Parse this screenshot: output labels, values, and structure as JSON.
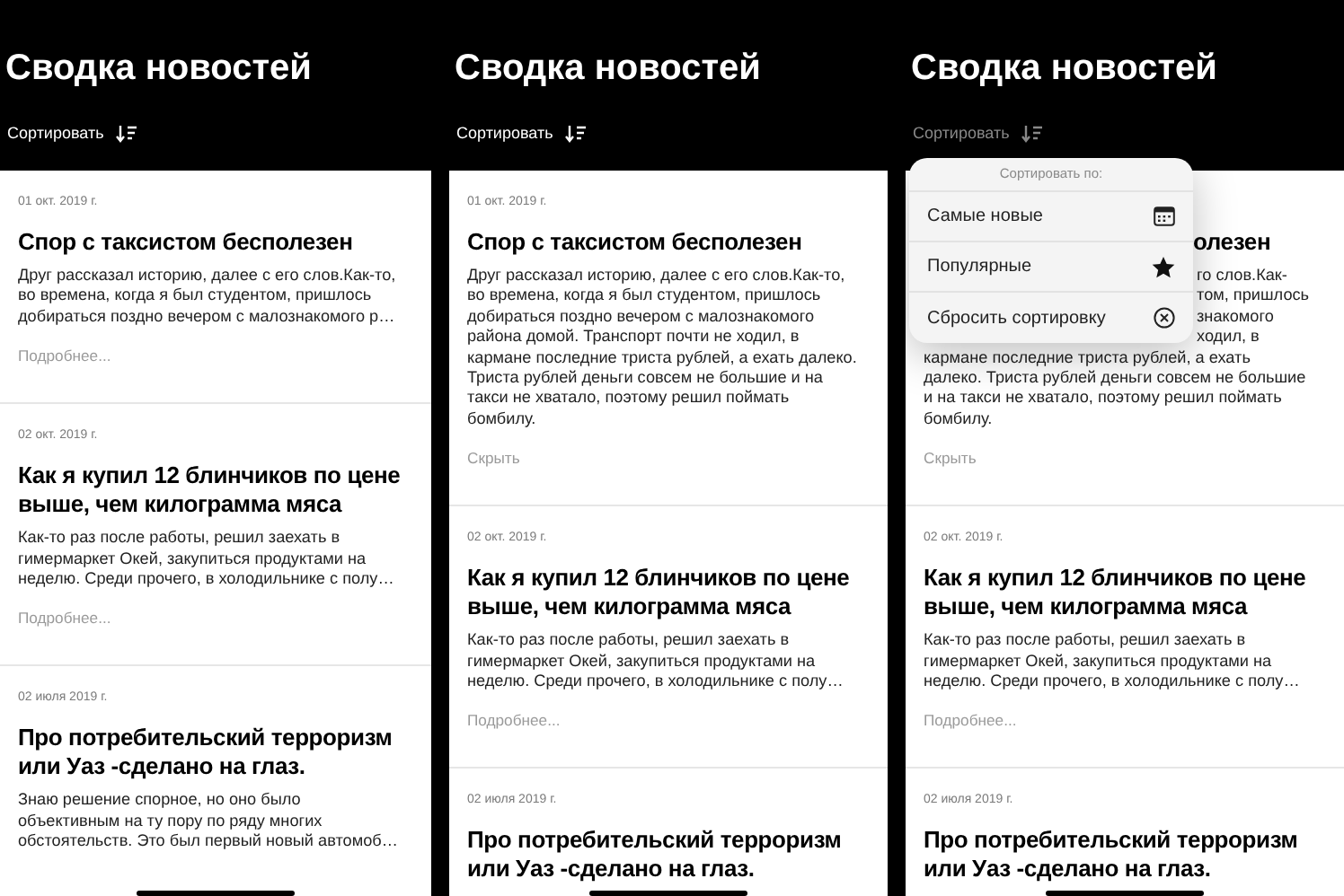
{
  "screens": [
    {
      "title": "Сводка новостей",
      "sort_label": "Сортировать",
      "sort_dimmed": false,
      "articles": [
        {
          "kind": "full",
          "date": "01 окт. 2019 г.",
          "title": "Спор с таксистом бесполезен",
          "body": "Друг рассказал историю, далее с его слов.Как-то, во времена, когда я был студентом, пришлось добираться поздно вечером с малознакомого р…",
          "link": "Подробнее..."
        },
        {
          "kind": "full",
          "date": "02 окт. 2019 г.",
          "title": "Как я купил 12 блинчиков по цене выше, чем килограмма мяса",
          "body": "Как-то раз после работы, решил заехать в гимермаркет Окей, закупиться продуктами на неделю. Среди прочего, в холодильнике с полу…",
          "link": "Подробнее..."
        },
        {
          "kind": "full",
          "date": "02 июля 2019 г.",
          "title": "Про потребительский терроризм или Уаз -сделано на глаз.",
          "body": "Знаю решение спорное, но оно было объективным на ту пору по ряду многих обстоятельств. Это был первый новый автомоб…"
        }
      ]
    },
    {
      "title": "Сводка новостей",
      "sort_label": "Сортировать",
      "sort_dimmed": false,
      "articles": [
        {
          "kind": "full",
          "date": "01 окт. 2019 г.",
          "title": "Спор с таксистом бесполезен",
          "body": "Друг рассказал историю, далее с его слов.Как-то, во времена, когда я был студентом, пришлось добираться поздно вечером с малознакомого района домой. Транспорт почти не ходил, в кармане последние триста рублей, а ехать далеко. Триста рублей деньги совсем не большие и на такси не хватало, поэтому решил поймать бомбилу.",
          "link": "Скрыть"
        },
        {
          "kind": "full",
          "date": "02 окт. 2019 г.",
          "title": "Как я купил 12 блинчиков по цене выше, чем килограмма мяса",
          "body": "Как-то раз после работы, решил заехать в гимермаркет Окей, закупиться продуктами на неделю. Среди прочего, в холодильнике с полу…",
          "link": "Подробнее..."
        },
        {
          "kind": "full",
          "date": "02 июля 2019 г.",
          "title": "Про потребительский терроризм или Уаз -сделано на глаз."
        }
      ]
    },
    {
      "title": "Сводка новостей",
      "sort_label": "Сортировать",
      "sort_dimmed": true,
      "sort_menu": {
        "header": "Сортировать по:",
        "items": [
          {
            "label": "Самые новые",
            "kind": "calendar"
          },
          {
            "label": "Популярные",
            "kind": "star"
          },
          {
            "label": "Сбросить сортировку",
            "kind": "reset"
          }
        ]
      },
      "articles": [
        {
          "kind": "covered",
          "title": "олезен",
          "covered_lines": [
            "го слов.Как-",
            "том, пришлось",
            "знакомого",
            "ходил, в"
          ],
          "lines": [
            "кармане последние триста рублей, а ехать",
            "далеко. Триста рублей деньги совсем не большие",
            "и на такси не хватало, поэтому решил поймать",
            "бомбилу."
          ],
          "link": "Скрыть"
        },
        {
          "kind": "full",
          "date": "02 окт. 2019 г.",
          "title": "Как я купил 12 блинчиков по цене выше, чем килограмма мяса",
          "body": "Как-то раз после работы, решил заехать в гимермаркет Окей, закупиться продуктами на неделю. Среди прочего, в холодильнике с полу…",
          "link": "Подробнее..."
        },
        {
          "kind": "full",
          "date": "02 июля 2019 г.",
          "title": "Про потребительский терроризм или Уаз -сделано на глаз."
        }
      ]
    }
  ]
}
